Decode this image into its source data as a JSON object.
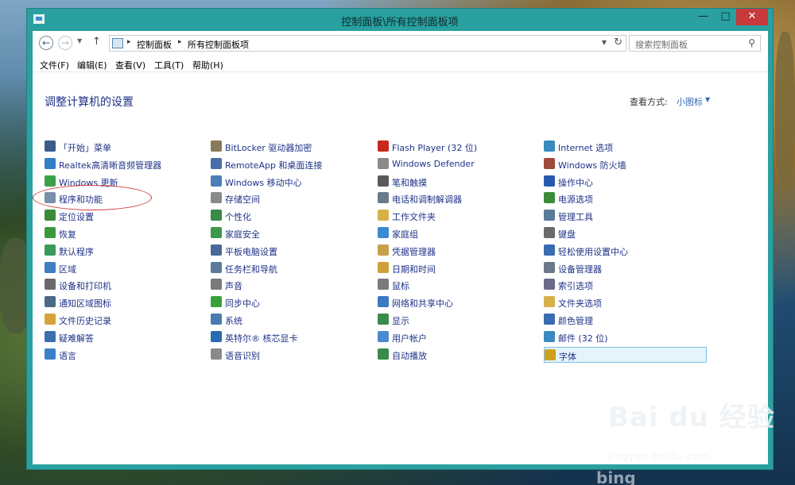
{
  "window": {
    "title": "控制面板\\所有控制面板项",
    "minimize": "—",
    "maximize": "□",
    "close": "✕"
  },
  "address": {
    "crumbs": [
      "控制面板",
      "所有控制面板项"
    ],
    "search_placeholder": "搜索控制面板"
  },
  "menu": [
    "文件(F)",
    "编辑(E)",
    "查看(V)",
    "工具(T)",
    "帮助(H)"
  ],
  "content": {
    "heading": "调整计算机的设置",
    "view_by_label": "查看方式:",
    "view_by_value": "小图标"
  },
  "columns": [
    [
      {
        "label": "「开始」菜单",
        "icon": "start-menu-icon",
        "color": "#3b5b8a"
      },
      {
        "label": "Realtek高清晰音频管理器",
        "icon": "realtek-audio-icon",
        "color": "#2f7fc4"
      },
      {
        "label": "Windows 更新",
        "icon": "windows-update-icon",
        "color": "#3aa04a"
      },
      {
        "label": "程序和功能",
        "icon": "programs-icon",
        "color": "#7a8fa8"
      },
      {
        "label": "定位设置",
        "icon": "location-icon",
        "color": "#3a8a3a"
      },
      {
        "label": "恢复",
        "icon": "recovery-icon",
        "color": "#3c9a3c"
      },
      {
        "label": "默认程序",
        "icon": "default-programs-icon",
        "color": "#3a9a5a"
      },
      {
        "label": "区域",
        "icon": "region-icon",
        "color": "#3d7fc0"
      },
      {
        "label": "设备和打印机",
        "icon": "printer-icon",
        "color": "#6a6a6a"
      },
      {
        "label": "通知区域图标",
        "icon": "notification-icon",
        "color": "#4a6a8a"
      },
      {
        "label": "文件历史记录",
        "icon": "file-history-icon",
        "color": "#d8a23a"
      },
      {
        "label": "疑难解答",
        "icon": "troubleshoot-icon",
        "color": "#3a6fb0"
      },
      {
        "label": "语言",
        "icon": "language-icon",
        "color": "#3a7fc8"
      }
    ],
    [
      {
        "label": "BitLocker 驱动器加密",
        "icon": "bitlocker-icon",
        "color": "#8a7a5a"
      },
      {
        "label": "RemoteApp 和桌面连接",
        "icon": "remoteapp-icon",
        "color": "#4a6fa8"
      },
      {
        "label": "Windows 移动中心",
        "icon": "mobility-center-icon",
        "color": "#4a7fb8"
      },
      {
        "label": "存储空间",
        "icon": "storage-spaces-icon",
        "color": "#8a8a8a"
      },
      {
        "label": "个性化",
        "icon": "personalization-icon",
        "color": "#3a8a4a"
      },
      {
        "label": "家庭安全",
        "icon": "family-safety-icon",
        "color": "#3a9a4a"
      },
      {
        "label": "平板电脑设置",
        "icon": "tablet-settings-icon",
        "color": "#4a6a9a"
      },
      {
        "label": "任务栏和导航",
        "icon": "taskbar-icon",
        "color": "#5a7a9a"
      },
      {
        "label": "声音",
        "icon": "sound-icon",
        "color": "#7a7a7a"
      },
      {
        "label": "同步中心",
        "icon": "sync-center-icon",
        "color": "#3aa03a"
      },
      {
        "label": "系统",
        "icon": "system-icon",
        "color": "#4a7ab0"
      },
      {
        "label": "英特尔® 核芯显卡",
        "icon": "intel-graphics-icon",
        "color": "#2a6ab0"
      },
      {
        "label": "语音识别",
        "icon": "speech-recognition-icon",
        "color": "#8a8a8a"
      }
    ],
    [
      {
        "label": "Flash Player (32 位)",
        "icon": "flash-player-icon",
        "color": "#c8281e"
      },
      {
        "label": "Windows Defender",
        "icon": "windows-defender-icon",
        "color": "#8a8a8a"
      },
      {
        "label": "笔和触摸",
        "icon": "pen-touch-icon",
        "color": "#5a5a5a"
      },
      {
        "label": "电话和调制解调器",
        "icon": "phone-modem-icon",
        "color": "#6a7a8a"
      },
      {
        "label": "工作文件夹",
        "icon": "work-folders-icon",
        "color": "#d8b04a"
      },
      {
        "label": "家庭组",
        "icon": "homegroup-icon",
        "color": "#3a8ad0"
      },
      {
        "label": "凭据管理器",
        "icon": "credential-manager-icon",
        "color": "#c8a04a"
      },
      {
        "label": "日期和时间",
        "icon": "date-time-icon",
        "color": "#d0a03a"
      },
      {
        "label": "鼠标",
        "icon": "mouse-icon",
        "color": "#7a7a7a"
      },
      {
        "label": "网络和共享中心",
        "icon": "network-icon",
        "color": "#3a7ac0"
      },
      {
        "label": "显示",
        "icon": "display-icon",
        "color": "#3a8a4a"
      },
      {
        "label": "用户帐户",
        "icon": "user-accounts-icon",
        "color": "#4a8ad0"
      },
      {
        "label": "自动播放",
        "icon": "autoplay-icon",
        "color": "#3a8a4a"
      }
    ],
    [
      {
        "label": "Internet 选项",
        "icon": "internet-options-icon",
        "color": "#3a8ac0"
      },
      {
        "label": "Windows 防火墙",
        "icon": "firewall-icon",
        "color": "#a04a3a"
      },
      {
        "label": "操作中心",
        "icon": "action-center-icon",
        "color": "#2a5ab0"
      },
      {
        "label": "电源选项",
        "icon": "power-options-icon",
        "color": "#3a8a3a"
      },
      {
        "label": "管理工具",
        "icon": "admin-tools-icon",
        "color": "#5a7a9a"
      },
      {
        "label": "键盘",
        "icon": "keyboard-icon",
        "color": "#6a6a6a"
      },
      {
        "label": "轻松使用设置中心",
        "icon": "ease-of-access-icon",
        "color": "#3a6ab0"
      },
      {
        "label": "设备管理器",
        "icon": "device-manager-icon",
        "color": "#6a7a8a"
      },
      {
        "label": "索引选项",
        "icon": "indexing-options-icon",
        "color": "#6a6a8a"
      },
      {
        "label": "文件夹选项",
        "icon": "folder-options-icon",
        "color": "#d8b04a"
      },
      {
        "label": "颜色管理",
        "icon": "color-management-icon",
        "color": "#3a6ab0"
      },
      {
        "label": "邮件 (32 位)",
        "icon": "mail-icon",
        "color": "#3a8ac0"
      },
      {
        "label": "字体",
        "icon": "fonts-icon",
        "color": "#d0a020"
      }
    ]
  ],
  "highlighted_item": "字体",
  "watermark": {
    "main": "Bai du 经验",
    "sub": "jingyan.baidu.com"
  },
  "desktop_logo": "bing"
}
